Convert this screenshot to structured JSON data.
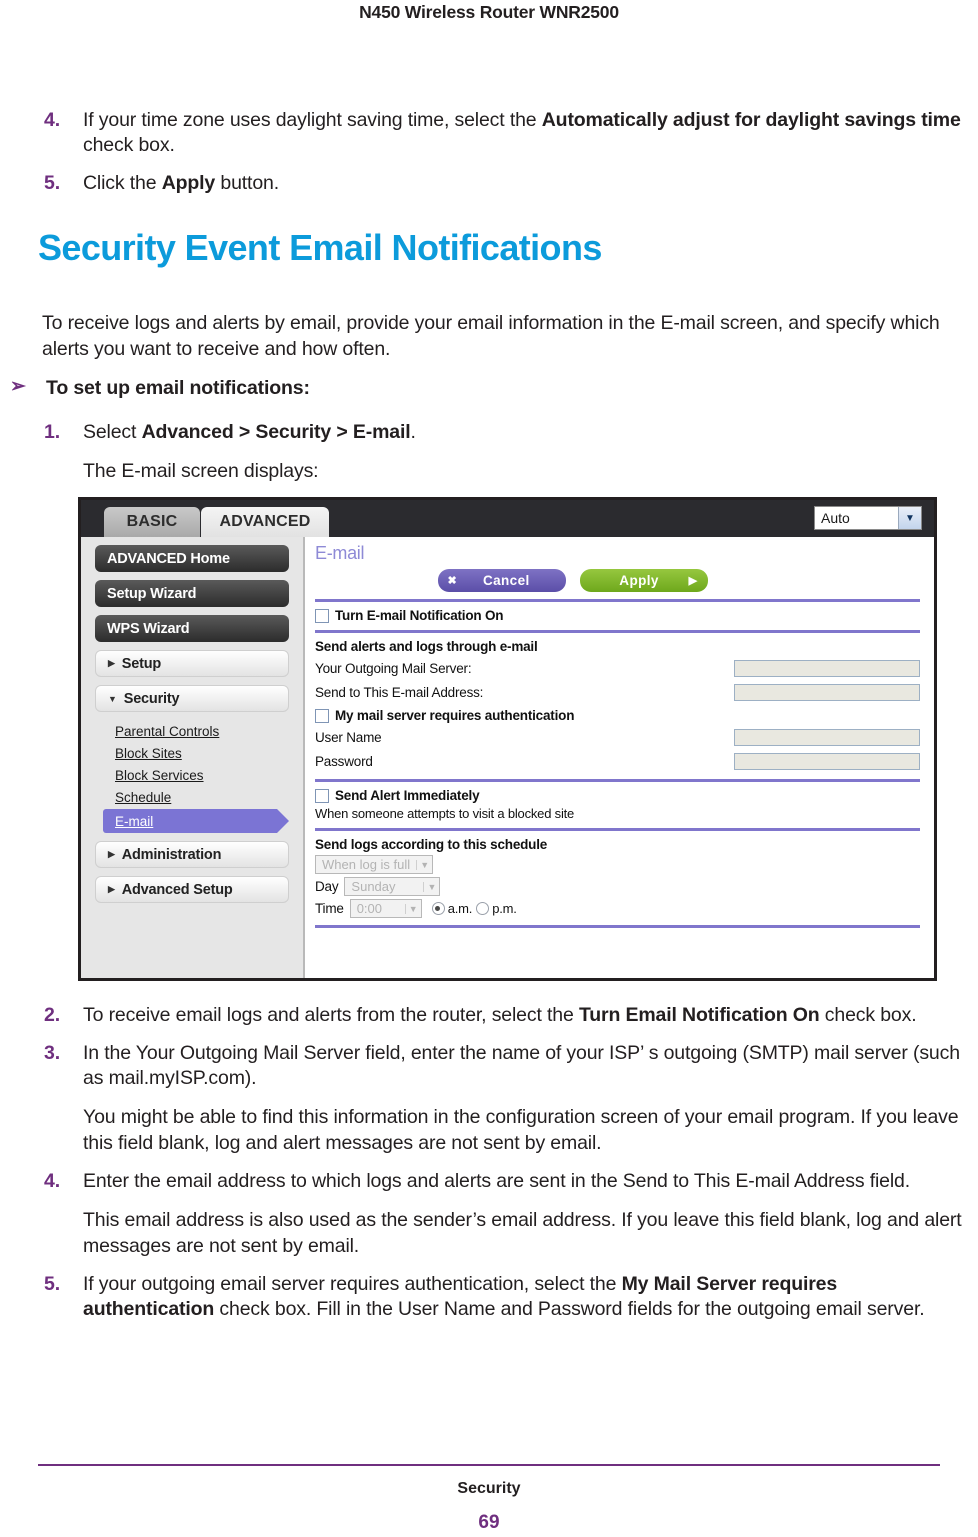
{
  "running_head": "N450 Wireless Router WNR2500",
  "steps_top": [
    {
      "num": "4.",
      "parts": [
        {
          "t": "If your time zone uses daylight saving time, select the ",
          "b": false
        },
        {
          "t": " Automatically adjust for daylight savings time",
          "b": true
        },
        {
          "t": " check box.",
          "b": false
        }
      ]
    },
    {
      "num": "5.",
      "parts": [
        {
          "t": "Click the ",
          "b": false
        },
        {
          "t": "Apply",
          "b": true
        },
        {
          "t": " button.",
          "b": false
        }
      ]
    }
  ],
  "section_heading": "Security Event Email Notifications",
  "intro": "To receive logs and alerts by email, provide your email information in the E-mail screen, and specify which alerts you want to receive and how often.",
  "leadin": {
    "arrow": "➢",
    "text": "To set up email notifications:"
  },
  "steps_mid": [
    {
      "num": "1.",
      "parts": [
        {
          "t": "Select ",
          "b": false
        },
        {
          "t": "Advanced > Security > E-mail",
          "b": true
        },
        {
          "t": ".",
          "b": false
        }
      ]
    }
  ],
  "caption": "The E-mail screen displays:",
  "screenshot": {
    "tabs": {
      "basic": "BASIC",
      "advanced": "ADVANCED"
    },
    "language_select": {
      "value": "Auto",
      "caret": "▼"
    },
    "sidebar": {
      "primary": [
        {
          "label": "ADVANCED Home",
          "style": "dark"
        },
        {
          "label": "Setup Wizard",
          "style": "dark"
        },
        {
          "label": "WPS Wizard",
          "style": "dark"
        }
      ],
      "groups": [
        {
          "label": "Setup",
          "tri": "▶"
        },
        {
          "label": "Security",
          "tri": "▼"
        }
      ],
      "security_children": [
        {
          "label": "Parental Controls",
          "active": false
        },
        {
          "label": "Block Sites",
          "active": false
        },
        {
          "label": "Block Services",
          "active": false
        },
        {
          "label": "Schedule",
          "active": false
        },
        {
          "label": "E-mail",
          "active": true
        }
      ],
      "trailing": [
        {
          "label": "Administration",
          "tri": "▶"
        },
        {
          "label": "Advanced Setup",
          "tri": "▶"
        }
      ]
    },
    "panel": {
      "title": "E-mail",
      "buttons": {
        "cancel_glyph": "✖",
        "cancel_label": "Cancel",
        "apply_label": "Apply",
        "apply_glyph": "▶"
      },
      "turn_on_checkbox": "Turn E-mail Notification On",
      "section_send": "Send alerts and logs through e-mail",
      "outgoing_label": "Your Outgoing Mail Server:",
      "sendto_label": "Send to This E-mail Address:",
      "auth_checkbox": "My mail server requires authentication",
      "username_label": "User Name",
      "password_label": "Password",
      "alert_checkbox": "Send Alert Immediately",
      "alert_note": "When someone attempts to visit a blocked site",
      "schedule_heading": "Send logs according to this schedule",
      "schedule_select": "When log is full",
      "day_label": "Day",
      "day_select": "Sunday",
      "time_label": "Time",
      "time_select": "0:00",
      "am_label": "a.m.",
      "pm_label": "p.m.",
      "select_caret": "▼"
    }
  },
  "steps_bottom": [
    {
      "num": "2.",
      "parts": [
        {
          "t": "To receive email logs and alerts from the  router, select the ",
          "b": false
        },
        {
          "t": "Turn Email Notification On",
          "b": true
        },
        {
          "t": " check box.",
          "b": false
        }
      ]
    },
    {
      "num": "3.",
      "parts": [
        {
          "t": "In the Your Outgoing Mail Server field, enter the name of your ISP’ s outgoing (SMTP) mail server (such as mail.myISP.com).",
          "b": false
        }
      ]
    }
  ],
  "para_3": "You might be able to find this information in the configuration screen of your email program. If you leave this field blank, log and alert messages are not sent by email.",
  "step_4": {
    "num": "4.",
    "parts": [
      {
        "t": "Enter the email address to which logs and alerts are sent in the Send to This E-mail Address field.",
        "b": false
      }
    ]
  },
  "para_4": "This email address is also used as the sender’s email address. If you leave this field blank, log and alert messages are not sent by email.",
  "step_5": {
    "num": "5.",
    "parts": [
      {
        "t": "If your outgoing email server requires authentication, select the ",
        "b": false
      },
      {
        "t": " My Mail Server requires authentication",
        "b": true
      },
      {
        "t": " check box. Fill in the User Name and Password fields for the outgoing email server.",
        "b": false
      }
    ]
  },
  "footer": {
    "chapter": "Security",
    "page": "69"
  },
  "colors": {
    "heading_blue": "#0C9BDB",
    "accent_purple": "#6F2F7F",
    "ui_purple": "#7B74D4",
    "apply_green": "#7DBB2E"
  }
}
